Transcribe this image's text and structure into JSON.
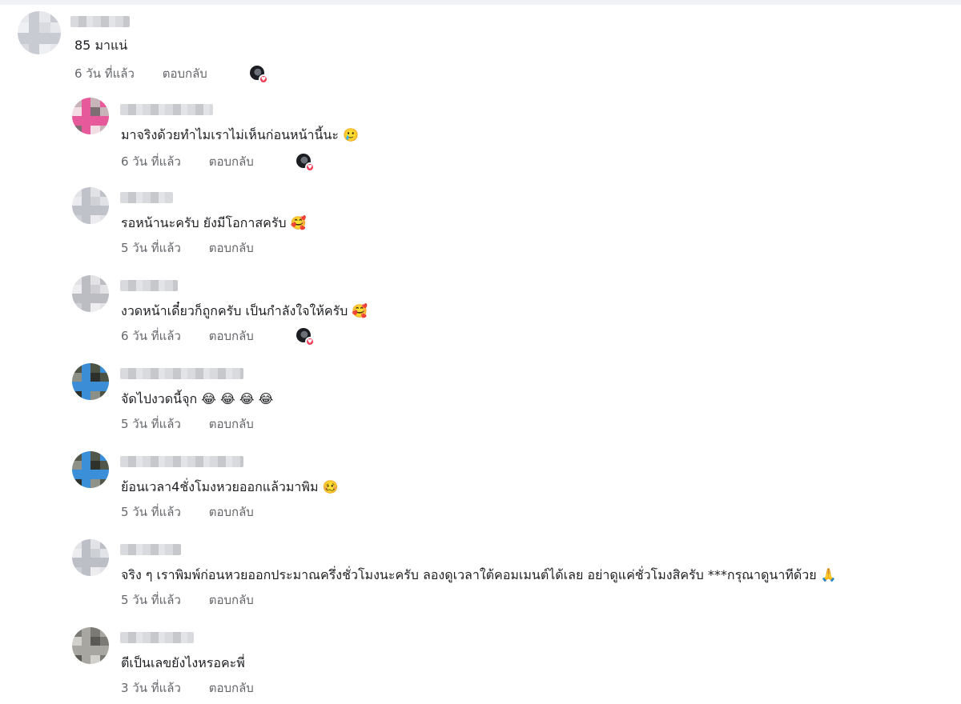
{
  "reply_label": "ตอบกลับ",
  "comments": [
    {
      "text": "85 มาแน่",
      "emoji": "",
      "time": "6 วัน ที่แล้ว",
      "reacted": true,
      "avatar_colors": [
        "#e7e8ec",
        "#d9dbe0",
        "#c9cbd2",
        "#eef0f3"
      ]
    },
    {
      "text": "มาจริงด้วยทำไมเราไม่เห็นก่อนหน้านี้นะ",
      "emoji": "🥲",
      "time": "6 วัน ที่แล้ว",
      "reacted": true,
      "avatar_colors": [
        "#c8b4b8",
        "#7d6e73",
        "#e65a9c",
        "#f1dde3"
      ]
    },
    {
      "text": "รอหน้านะครับ ยังมีโอกาสครับ",
      "emoji": "🥰",
      "time": "5 วัน ที่แล้ว",
      "reacted": false,
      "avatar_colors": [
        "#e1e2e6",
        "#cfd1d6",
        "#bfc2c9",
        "#ececf0"
      ]
    },
    {
      "text": "งวดหน้าเดี๋ยวก็ถูกครับ เป็นกำลังใจให้ครับ",
      "emoji": "🥰",
      "time": "6 วัน ที่แล้ว",
      "reacted": true,
      "avatar_colors": [
        "#e3e3e6",
        "#cfcfd4",
        "#bcbcc3",
        "#eeeef1"
      ]
    },
    {
      "text": "จัดไปงวดนี้จุก",
      "emoji": "😂 😂 😂 😂",
      "time": "5 วัน ที่แล้ว",
      "reacted": false,
      "avatar_colors": [
        "#4c5345",
        "#2d302a",
        "#3b8ed6",
        "#8b8f86"
      ]
    },
    {
      "text": "ย้อนเวลา4ชั่งโมงหวยออกแล้วมาพิม",
      "emoji": "🥴",
      "time": "5 วัน ที่แล้ว",
      "reacted": false,
      "avatar_colors": [
        "#51574a",
        "#2e322b",
        "#3a8fd8",
        "#8e9289"
      ]
    },
    {
      "text": "จริง ๆ เราพิมพ์ก่อนหวยออกประมาณครึ่งชั่วโมงนะครับ ลองดูเวลาใต้คอมเมนต์ได้เลย อย่าดูแค่ชั่วโมงสิครับ ***กรุณาดูนาทีด้วย",
      "emoji": "🙏",
      "time": "5 วัน ที่แล้ว",
      "reacted": false,
      "avatar_colors": [
        "#e2e3e7",
        "#cdd0d5",
        "#bcbfc6",
        "#ededf0"
      ]
    },
    {
      "text": "ตีเป็นเลขยังไงหรอคะพี่",
      "emoji": "",
      "time": "3 วัน ที่แล้ว",
      "reacted": false,
      "avatar_colors": [
        "#7c7a75",
        "#5b5955",
        "#a8a6a0",
        "#d2d0cb"
      ]
    }
  ]
}
